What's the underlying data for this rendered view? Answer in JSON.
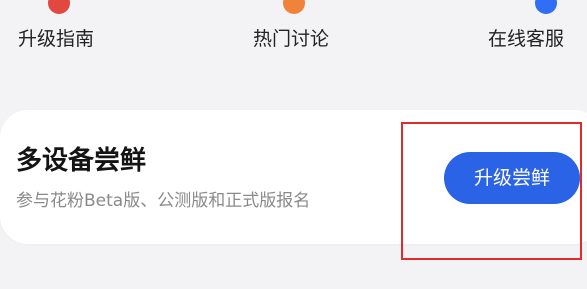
{
  "top_nav": {
    "items": [
      {
        "label": "升级指南",
        "icon": "guide-icon",
        "icon_color": "#e2483f"
      },
      {
        "label": "热门讨论",
        "icon": "discussion-icon",
        "icon_color": "#f1823a"
      },
      {
        "label": "在线客服",
        "icon": "support-icon",
        "icon_color": "#2f6ef5"
      }
    ]
  },
  "card": {
    "title": "多设备尝鲜",
    "subtitle": "参与花粉Beta版、公测版和正式版报名",
    "button_label": "升级尝鲜",
    "button_color": "#2a63e6"
  },
  "highlight": {
    "color": "#e12a2a"
  }
}
